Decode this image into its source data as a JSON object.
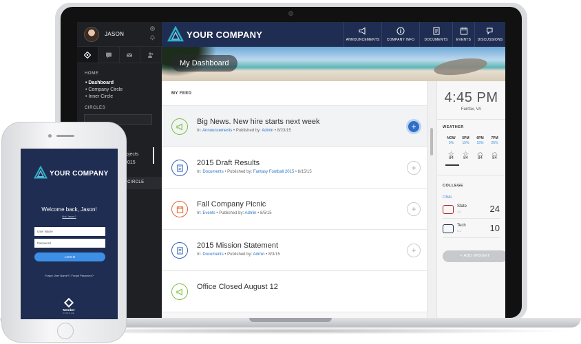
{
  "laptop": {
    "user": {
      "name": "JASON"
    },
    "sidebar": {
      "home_section": "HOME",
      "home_items": [
        "Dashboard",
        "Company Circle",
        "Inner Circle"
      ],
      "circles_section": "CIRCLES",
      "partial_items": [
        "Projects",
        "ll 2015"
      ],
      "band_label": "A CIRCLE"
    },
    "header": {
      "company": "YOUR COMPANY",
      "nav": [
        {
          "label": "ANNOUNCEMENTS",
          "icon": "megaphone-icon"
        },
        {
          "label": "COMPANY INFO",
          "icon": "info-icon"
        },
        {
          "label": "DOCUMENTS",
          "icon": "document-icon"
        },
        {
          "label": "EVENTS",
          "icon": "calendar-icon"
        },
        {
          "label": "DISCUSSIONS",
          "icon": "chat-icon"
        }
      ]
    },
    "banner": {
      "title": "My Dashboard"
    },
    "feed": {
      "header": "MY FEED",
      "in_prefix": "In:",
      "published_prefix": "Published by:",
      "items": [
        {
          "title": "Big News. New hire starts next week",
          "category": "Announcements",
          "author": "Admin",
          "date": "8/23/15",
          "icon": "megaphone-icon",
          "color": "#7bbf3f"
        },
        {
          "title": "2015 Draft Results",
          "category": "Documents",
          "author": "Fantasy Football 2015",
          "date": "8/15/15",
          "icon": "document-icon",
          "color": "#2f63b4"
        },
        {
          "title": "Fall Company Picnic",
          "category": "Events",
          "author": "Admin",
          "date": "8/5/15",
          "icon": "calendar-icon",
          "color": "#e0622c"
        },
        {
          "title": "2015 Mission Statement",
          "category": "Documents",
          "author": "Admin",
          "date": "8/3/15",
          "icon": "document-icon",
          "color": "#2f63b4"
        },
        {
          "title": "Office Closed August 12",
          "category": "",
          "author": "",
          "date": "",
          "icon": "megaphone-icon",
          "color": "#7bbf3f"
        }
      ]
    },
    "right_panel": {
      "time": "4:45 PM",
      "city": "Fairfax, VA",
      "weather_title": "WEATHER",
      "weather": [
        {
          "time": "NOW",
          "pct": "5%",
          "icon": "sun-icon",
          "temp": "84"
        },
        {
          "time": "5PM",
          "pct": "15%",
          "icon": "sun-icon",
          "temp": "84"
        },
        {
          "time": "6PM",
          "pct": "15%",
          "icon": "cloud-icon",
          "temp": "84"
        },
        {
          "time": "7PM",
          "pct": "25%",
          "icon": "cloud-icon",
          "temp": "84"
        }
      ],
      "college_title": "COLLEGE",
      "final_label": "FINAL",
      "teams": [
        {
          "name": "State",
          "sub": "1-0",
          "score": "24",
          "color": "#b3202a"
        },
        {
          "name": "Tech",
          "sub": "0-1",
          "score": "10",
          "color": "#1f2d52"
        }
      ],
      "add_widget": "+ ADD WIDGET"
    }
  },
  "phone": {
    "company": "YOUR COMPANY",
    "welcome": "Welcome back, Jason!",
    "not_you": "Not Jason?",
    "username_placeholder": "User Name",
    "password_placeholder": "Password",
    "login": "LOGIN",
    "forgot": "Forgot User Name? | Forgot Password?",
    "brand": "Member",
    "brand_sub": "CIRCLE"
  },
  "colors": {
    "navy": "#1f2d52",
    "accent_blue": "#2f70c6",
    "link_blue": "#2b74c6"
  }
}
